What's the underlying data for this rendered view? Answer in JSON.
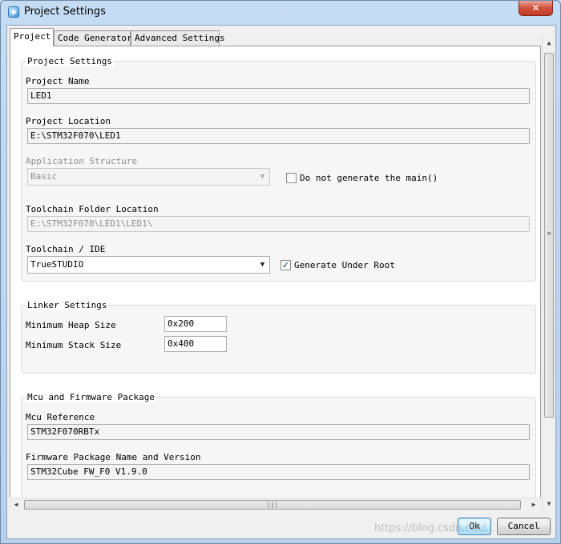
{
  "window": {
    "title": "Project Settings",
    "close_glyph": "✕"
  },
  "tabs": [
    {
      "label": "Project",
      "active": true
    },
    {
      "label": "Code Generator",
      "active": false
    },
    {
      "label": "Advanced Settings",
      "active": false
    }
  ],
  "project_settings": {
    "group_title": "Project Settings",
    "project_name_label": "Project Name",
    "project_name_value": "LED1",
    "project_location_label": "Project Location",
    "project_location_value": "E:\\STM32F070\\LED1",
    "app_structure_label": "Application Structure",
    "app_structure_value": "Basic",
    "do_not_generate_main_label": "Do not generate the main()",
    "do_not_generate_main_checked": false,
    "toolchain_folder_label": "Toolchain Folder Location",
    "toolchain_folder_value": "E:\\STM32F070\\LED1\\LED1\\",
    "toolchain_ide_label": "Toolchain / IDE",
    "toolchain_ide_value": "TrueSTUDIO",
    "generate_under_root_label": "Generate Under Root",
    "generate_under_root_checked": true
  },
  "linker_settings": {
    "group_title": "Linker Settings",
    "min_heap_label": "Minimum Heap Size",
    "min_heap_value": "0x200",
    "min_stack_label": "Minimum Stack Size",
    "min_stack_value": "0x400"
  },
  "mcu_firmware": {
    "group_title": "Mcu and Firmware Package",
    "mcu_reference_label": "Mcu Reference",
    "mcu_reference_value": "STM32F070RBTx",
    "firmware_label": "Firmware Package Name and Version",
    "firmware_value": "STM32Cube FW_F0 V1.9.0"
  },
  "buttons": {
    "ok": "Ok",
    "cancel": "Cancel"
  },
  "icons": {
    "dropdown": "▼",
    "check": "✓",
    "scroll_up": "▲",
    "scroll_down": "▼",
    "scroll_left": "◀",
    "scroll_right": "▶",
    "grip_h": "|||",
    "grip_v": "≡"
  },
  "watermark": "https://blog.csdn.net/..."
}
